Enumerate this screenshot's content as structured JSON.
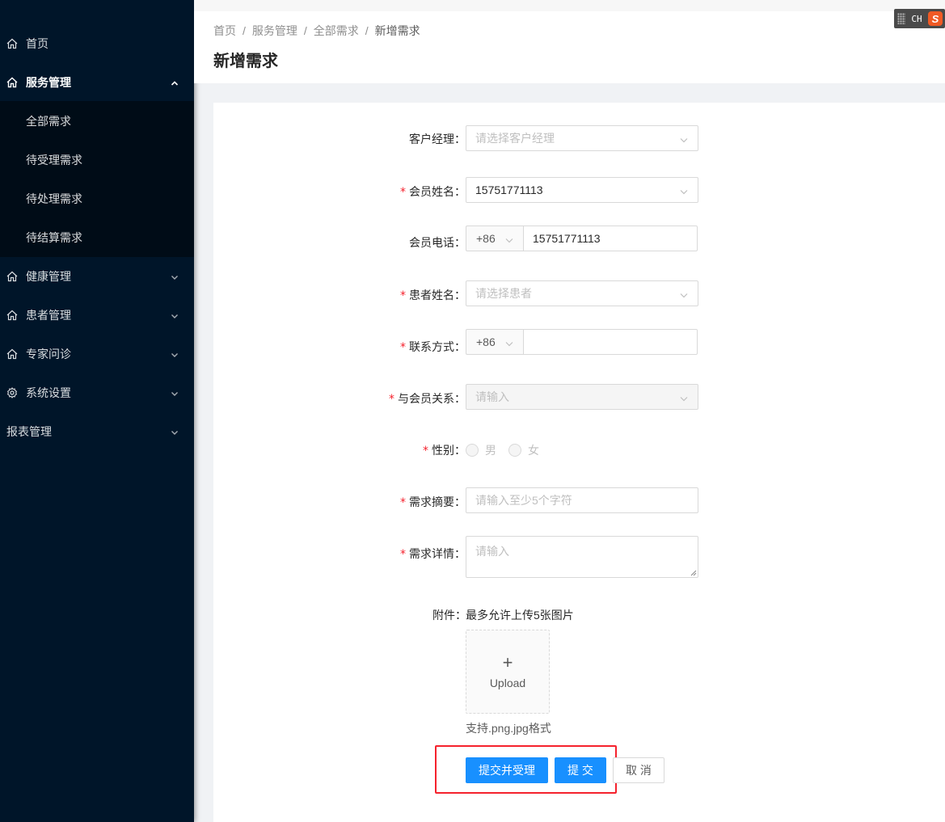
{
  "sidebar": {
    "home": "首页",
    "service": "服务管理",
    "service_sub": [
      "全部需求",
      "待受理需求",
      "待处理需求",
      "待结算需求"
    ],
    "health": "健康管理",
    "patients": "患者管理",
    "expert": "专家问诊",
    "settings": "系统设置",
    "reports": "报表管理"
  },
  "header": {
    "breadcrumb": [
      "首页",
      "服务管理",
      "全部需求",
      "新增需求"
    ],
    "breadcrumb_sep": "/",
    "title": "新增需求"
  },
  "ime": {
    "label": "CH",
    "logo": "S"
  },
  "form": {
    "manager": {
      "label": "客户经理：",
      "placeholder": "请选择客户经理"
    },
    "member_name": {
      "label": "会员姓名：",
      "value": "15751771113",
      "required_mark": "*"
    },
    "member_phone": {
      "label": "会员电话：",
      "prefix": "+86",
      "value": "15751771113"
    },
    "patient_name": {
      "label": "患者姓名：",
      "placeholder": "请选择患者",
      "required_mark": "*"
    },
    "contact": {
      "label": "联系方式：",
      "prefix": "+86",
      "value": "",
      "required_mark": "*"
    },
    "relation": {
      "label": "与会员关系：",
      "placeholder": "请输入",
      "required_mark": "*"
    },
    "gender": {
      "label": "性别：",
      "options": [
        "男",
        "女"
      ],
      "required_mark": "*"
    },
    "summary": {
      "label": "需求摘要：",
      "placeholder": "请输入至少5个字符",
      "required_mark": "*"
    },
    "detail": {
      "label": "需求详情：",
      "placeholder": "请输入",
      "required_mark": "*"
    },
    "attachment": {
      "label": "附件：",
      "note": "最多允许上传5张图片",
      "upload_plus": "+",
      "upload_text": "Upload",
      "format_hint": "支持.png.jpg格式"
    }
  },
  "actions": {
    "submit_accept": "提交并受理",
    "submit": "提 交",
    "cancel": "取 消"
  },
  "colors": {
    "sidebar_bg": "#001529",
    "submenu_bg": "#000c17",
    "primary": "#1890ff",
    "required": "#f5222d",
    "highlight_border": "#f5222d"
  }
}
